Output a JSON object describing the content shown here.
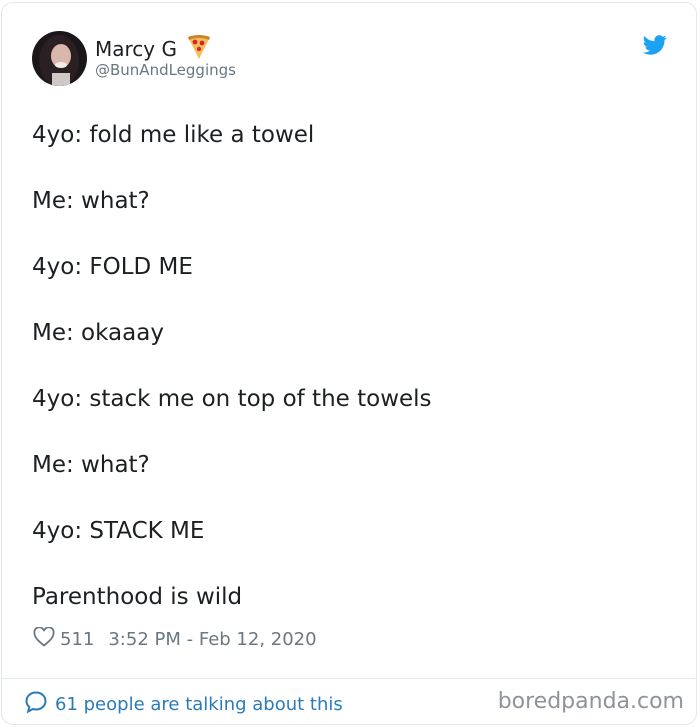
{
  "header": {
    "display_name": "Marcy G",
    "handle": "@BunAndLeggings",
    "emoji": "pizza-icon",
    "brand_icon": "twitter-bird-icon",
    "brand_color": "#1da1f2"
  },
  "tweet": {
    "lines": [
      "4yo: fold me like a towel",
      "Me: what?",
      "4yo: FOLD ME",
      "Me: okaaay",
      "4yo: stack me on top of the towels",
      "Me: what?",
      "4yo: STACK ME",
      "Parenthood is wild"
    ]
  },
  "meta": {
    "like_count": "511",
    "timestamp": "3:52 PM - Feb 12, 2020"
  },
  "footer": {
    "talking_text": "61 people are talking about this",
    "watermark": "boredpanda.com",
    "link_color": "#2b7bb9"
  }
}
